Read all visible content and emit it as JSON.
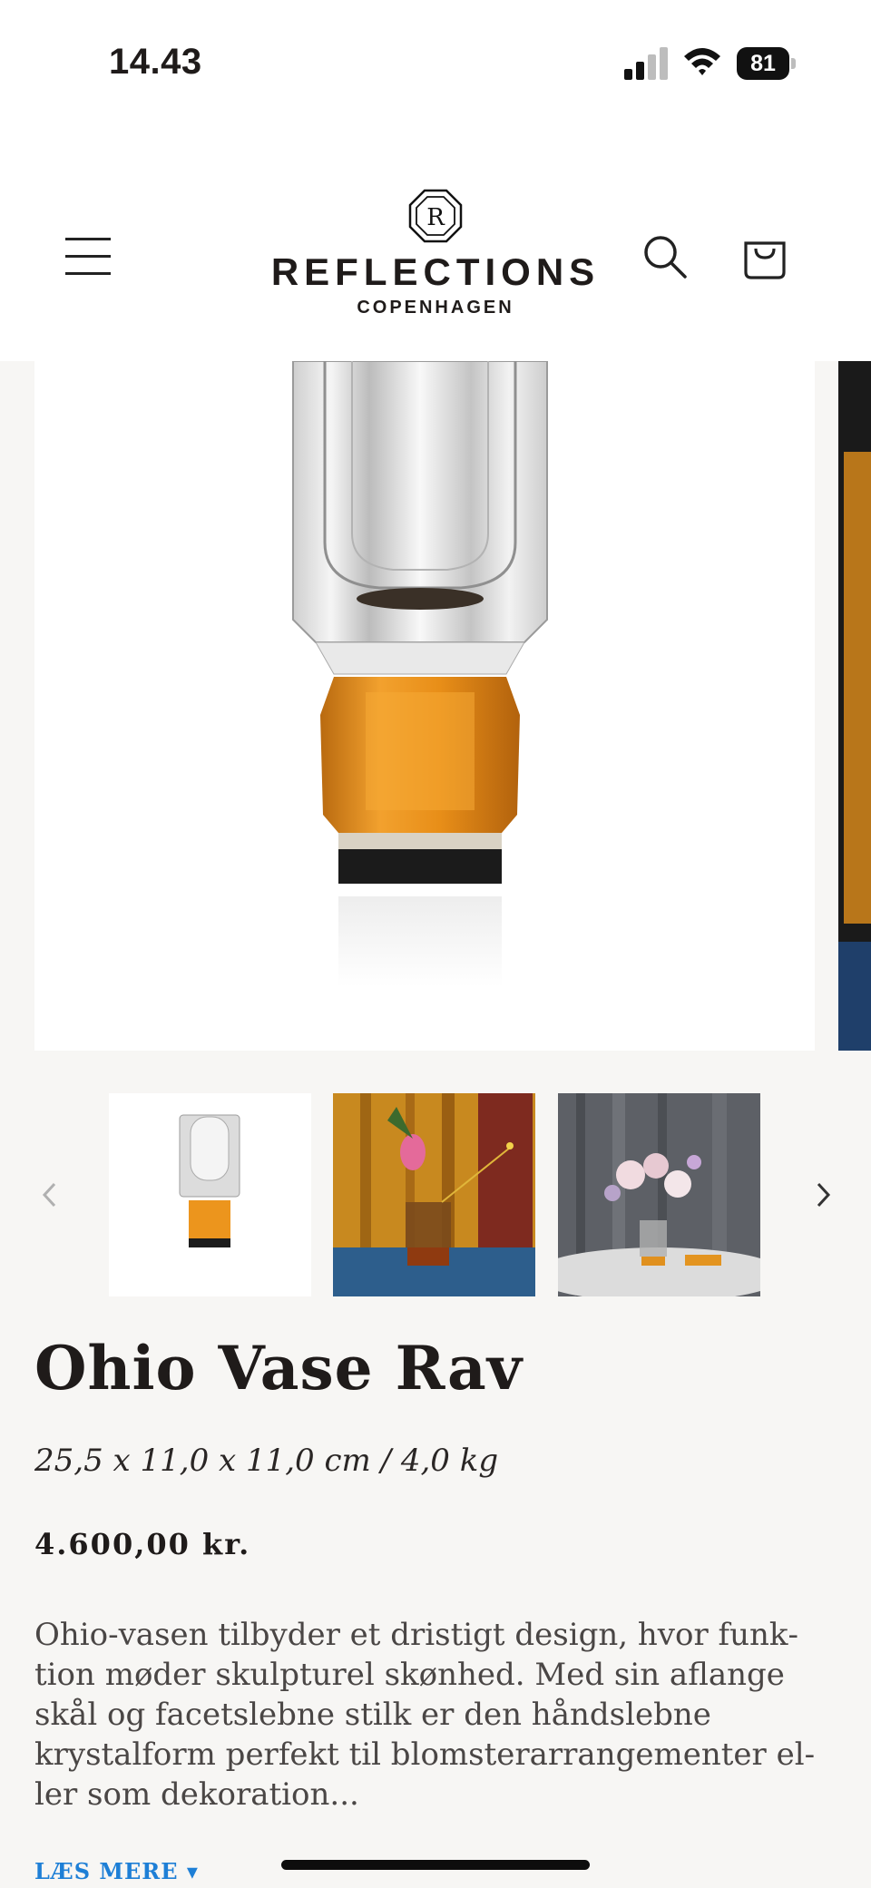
{
  "status_bar": {
    "time": "14.43",
    "battery_level": "81"
  },
  "header": {
    "brand_name": "REFLECTIONS",
    "brand_sub": "COPENHAGEN",
    "icons": [
      "menu-icon",
      "search-icon",
      "cart-icon"
    ]
  },
  "gallery": {
    "thumbnail_count": 3,
    "icons": [
      "chevron-left-icon",
      "chevron-right-icon"
    ]
  },
  "product": {
    "title": "Ohio Vase Rav",
    "dimensions": "25,5 x 11,0 x 11,0 cm / 4,0 kg",
    "price": "4.600,00 kr.",
    "description": "Ohio-vasen tilbyder et dristigt design, hvor funk­tion møder skulpturel skønhed. Med sin aflange skål og facetslebne stilk er den håndslebne krystalform perfekt til blomsterarrangementer el­ler som dekoration...",
    "read_more": "LÆS MERE ▾"
  },
  "colors": {
    "background": "#f7f6f4",
    "amber": "#e8901a",
    "link": "#1e7fd6",
    "text": "#1f1b1a"
  }
}
